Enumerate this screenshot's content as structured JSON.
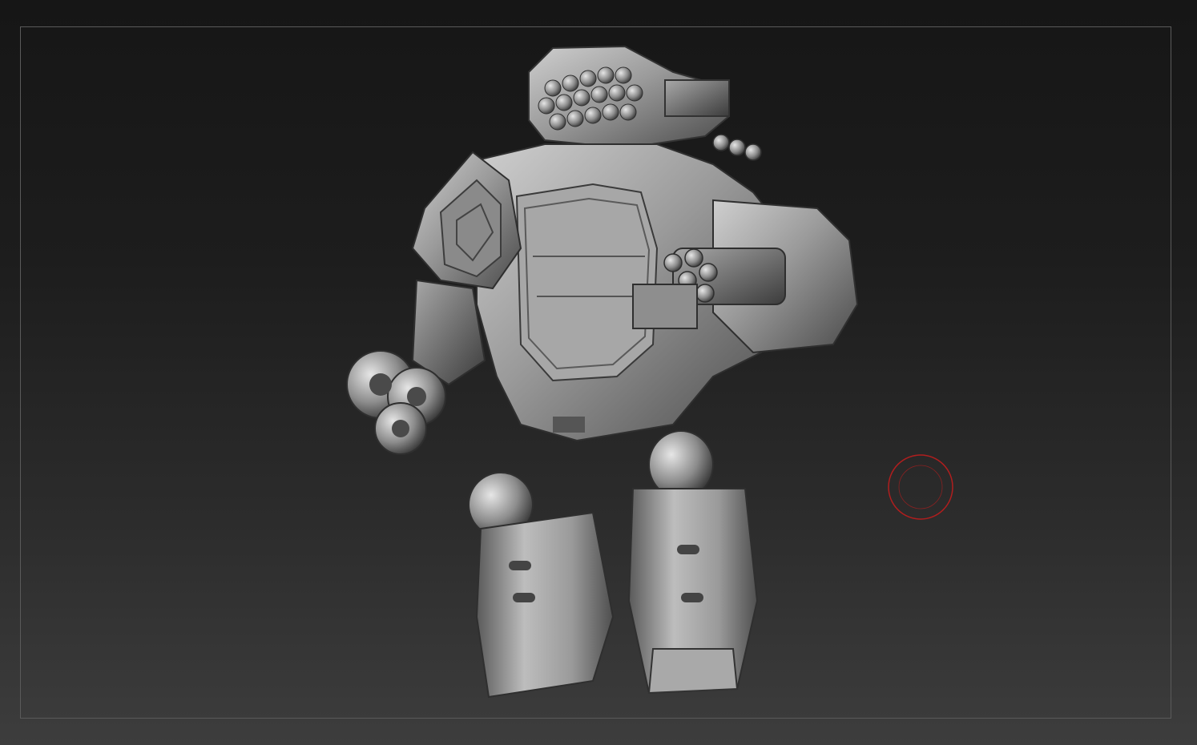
{
  "viewport": {
    "background_top": "#161616",
    "background_bottom": "#3d3d3d",
    "frame_color": "#5a5a5a",
    "model": {
      "icon": "dreadnought-sculpt",
      "material": "matcap-grey",
      "base_color": "#8a8a8a"
    },
    "brush_cursor": {
      "icon": "brush-circle-icon",
      "color": "#b01e1e"
    }
  }
}
